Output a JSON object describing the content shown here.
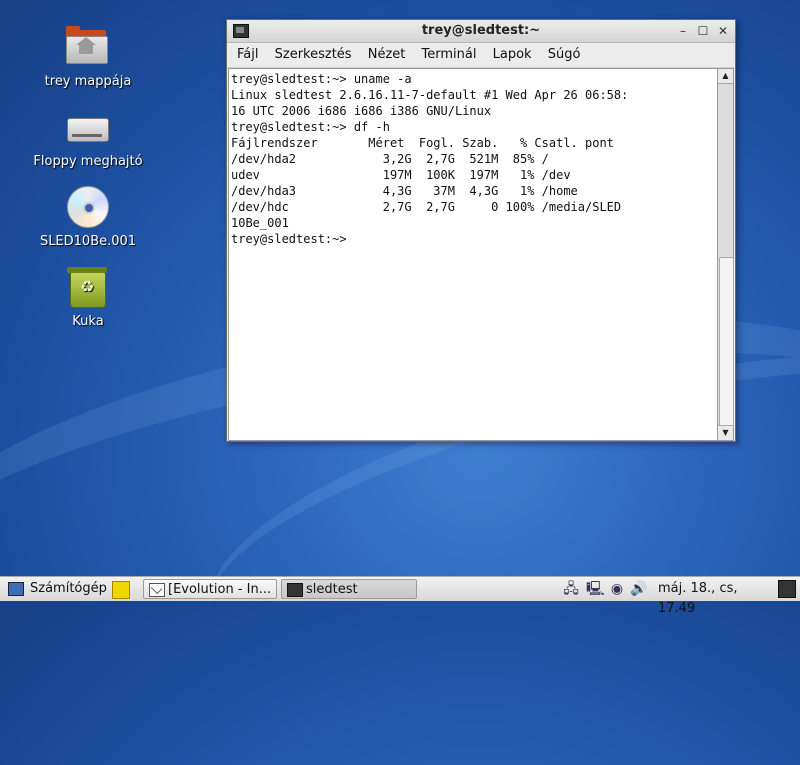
{
  "desktop": {
    "icons": [
      {
        "label": "trey mappája",
        "icon": "home-folder-icon"
      },
      {
        "label": "Floppy meghajtó",
        "icon": "floppy-drive-icon"
      },
      {
        "label": "SLED10Be.001",
        "icon": "cd-disc-icon"
      },
      {
        "label": "Kuka",
        "icon": "trash-icon"
      }
    ]
  },
  "window": {
    "title": "trey@sledtest:~",
    "controls": {
      "minimize": "–",
      "maximize": "☐",
      "close": "✕"
    },
    "menu": [
      {
        "label": "Fájl"
      },
      {
        "label": "Szerkesztés"
      },
      {
        "label": "Nézet"
      },
      {
        "label": "Terminál"
      },
      {
        "label": "Lapok"
      },
      {
        "label": "Súgó"
      }
    ],
    "terminal_lines": [
      "trey@sledtest:~> uname -a",
      "Linux sledtest 2.6.16.11-7-default #1 Wed Apr 26 06:58:",
      "16 UTC 2006 i686 i686 i386 GNU/Linux",
      "trey@sledtest:~> df -h",
      "Fájlrendszer       Méret  Fogl. Szab.   % Csatl. pont",
      "/dev/hda2            3,2G  2,7G  521M  85% /",
      "udev                 197M  100K  197M   1% /dev",
      "/dev/hda3            4,3G   37M  4,3G   1% /home",
      "/dev/hdc             2,7G  2,7G     0 100% /media/SLED",
      "10Be_001",
      "trey@sledtest:~> "
    ]
  },
  "taskbar": {
    "menu_label": "Számítógép",
    "tasks": [
      {
        "label": "[Evolution - In...",
        "icon": "mail-icon",
        "active": false
      },
      {
        "label": "sledtest",
        "icon": "terminal-icon",
        "active": true
      }
    ],
    "clock": "máj. 18., cs, 17.49"
  }
}
